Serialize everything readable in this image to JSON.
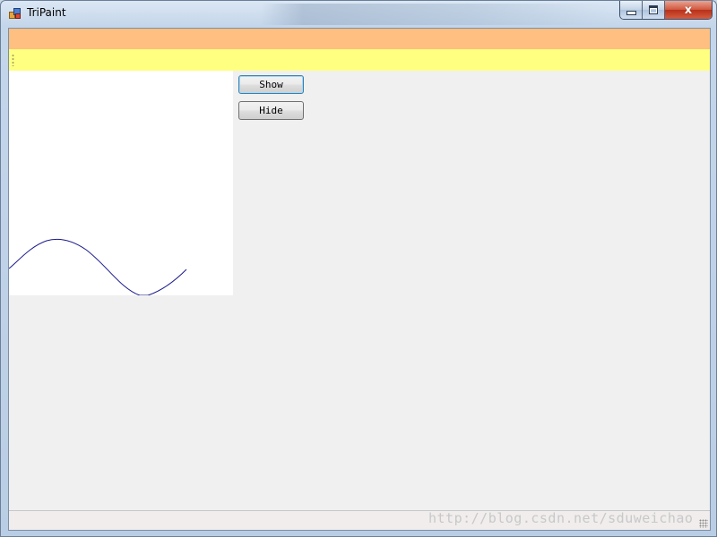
{
  "window": {
    "title": "TriPaint",
    "controls": {
      "minimize_icon": "minimize-icon",
      "maximize_icon": "maximize-icon",
      "close_icon": "close-icon",
      "close_glyph": "x"
    }
  },
  "menu": {
    "items": []
  },
  "toolbar": {
    "items": []
  },
  "canvas": {
    "background": "#ffffff",
    "stroke_color": "#1a1a8c"
  },
  "buttons": {
    "show_label": "Show",
    "hide_label": "Hide"
  },
  "status": {
    "text": ""
  },
  "watermark": "http://blog.csdn.net/sduweichao",
  "colors": {
    "menu_strip": "#ffbf80",
    "tool_strip": "#ffff80",
    "client_bg": "#f0f0f0"
  }
}
